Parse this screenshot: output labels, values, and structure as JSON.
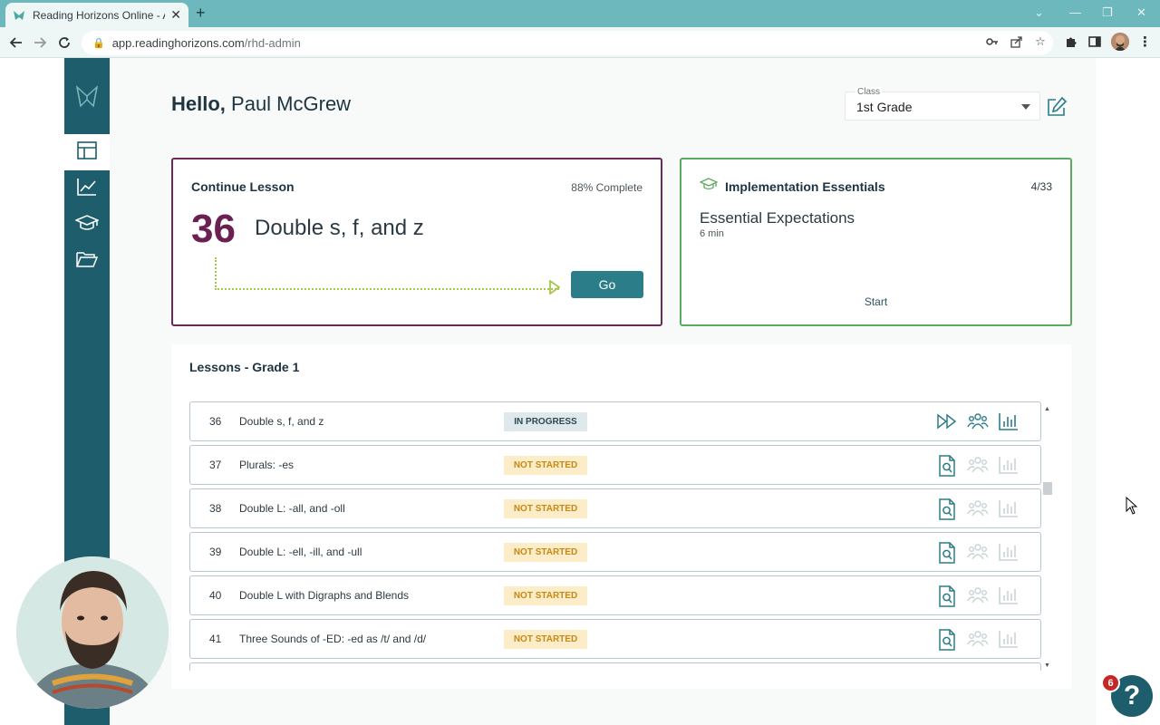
{
  "browser": {
    "tab_title": "Reading Horizons Online - Admi",
    "url_host": "app.readinghorizons.com",
    "url_path": "/rhd-admin"
  },
  "header": {
    "greeting_hello": "Hello,",
    "user_name": "Paul McGrew",
    "class_label": "Class",
    "class_value": "1st Grade"
  },
  "continue_lesson": {
    "title": "Continue Lesson",
    "percent_label": "88% Complete",
    "lesson_number": "36",
    "lesson_name": "Double s, f, and z",
    "go_label": "Go"
  },
  "implementation": {
    "title": "Implementation Essentials",
    "count": "4/33",
    "subtitle": "Essential Expectations",
    "duration": "6 min",
    "start_label": "Start"
  },
  "lessons": {
    "title": "Lessons - Grade 1",
    "rows": [
      {
        "number": "36",
        "name": "Double s, f, and z",
        "status": "IN PROGRESS"
      },
      {
        "number": "37",
        "name": "Plurals: -es",
        "status": "NOT STARTED"
      },
      {
        "number": "38",
        "name": "Double L: -all, and -oll",
        "status": "NOT STARTED"
      },
      {
        "number": "39",
        "name": "Double L: -ell, -ill, and -ull",
        "status": "NOT STARTED"
      },
      {
        "number": "40",
        "name": "Double L with Digraphs and Blends",
        "status": "NOT STARTED"
      },
      {
        "number": "41",
        "name": "Three Sounds of -ED: -ed as /t/ and /d/",
        "status": "NOT STARTED"
      }
    ]
  },
  "help": {
    "label": "?",
    "badge_count": "6"
  },
  "colors": {
    "sidebar": "#1e5d6b",
    "lesson_accent": "#6a2152",
    "impl_accent": "#5aab61",
    "go_button": "#2b7d8a",
    "not_started_bg": "#fcecc8"
  }
}
